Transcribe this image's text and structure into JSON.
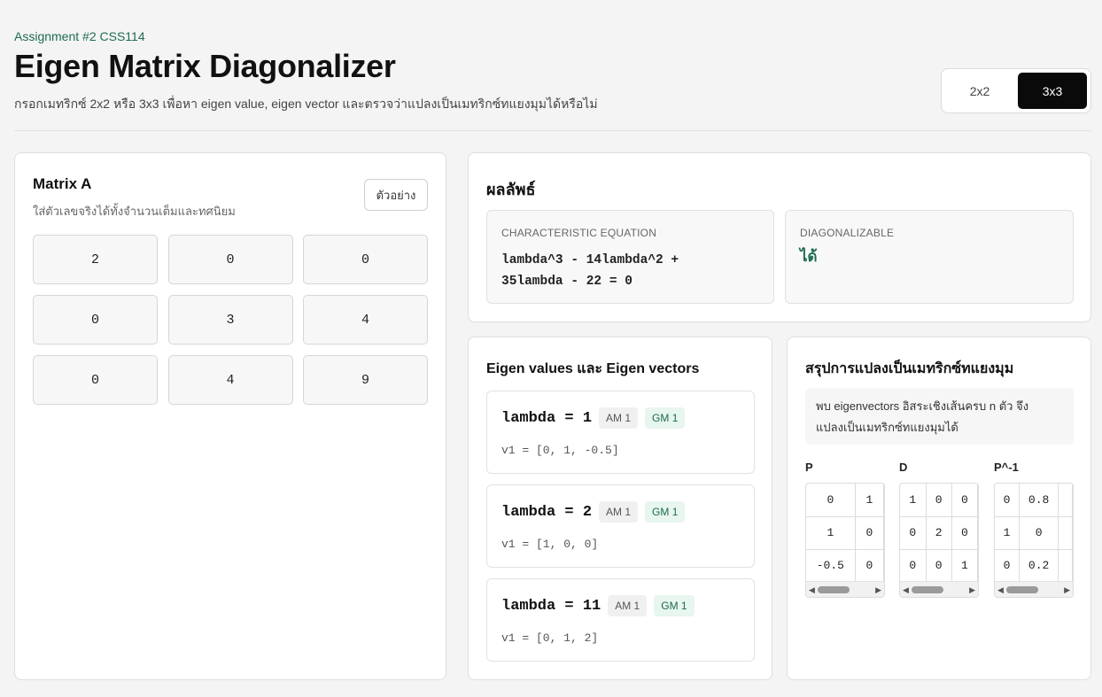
{
  "header": {
    "course": "Assignment #2 CSS114",
    "title": "Eigen Matrix Diagonalizer",
    "subtitle": "กรอกเมทริกซ์ 2x2 หรือ 3x3 เพื่อหา eigen value, eigen vector และตรวจว่าแปลงเป็นเมทริกซ์ทแยงมุมได้หรือไม่"
  },
  "size_toggle": {
    "options": [
      "2x2",
      "3x3"
    ],
    "selected": "3x3"
  },
  "matrix_card": {
    "title": "Matrix A",
    "hint": "ใส่ตัวเลขจริงได้ทั้งจำนวนเต็มและทศนิยม",
    "example_button": "ตัวอย่าง",
    "cells": [
      [
        "2",
        "0",
        "0"
      ],
      [
        "0",
        "3",
        "4"
      ],
      [
        "0",
        "4",
        "9"
      ]
    ]
  },
  "results": {
    "title": "ผลลัพธ์",
    "char_eq_label": "CHARACTERISTIC EQUATION",
    "char_eq_line1": "lambda^3 - 14lambda^2 +",
    "char_eq_line2": "35lambda - 22 = 0",
    "diag_label": "DIAGONALIZABLE",
    "diag_value": "ได้",
    "diag_color": "#1f6b4f"
  },
  "eigen": {
    "title": "Eigen values และ Eigen vectors",
    "items": [
      {
        "lambda": "lambda = 1",
        "am": "AM 1",
        "gm": "GM 1",
        "vector": "v1 = [0, 1, -0.5]"
      },
      {
        "lambda": "lambda = 2",
        "am": "AM 1",
        "gm": "GM 1",
        "vector": "v1 = [1, 0, 0]"
      },
      {
        "lambda": "lambda = 11",
        "am": "AM 1",
        "gm": "GM 1",
        "vector": "v1 = [0, 1, 2]"
      }
    ]
  },
  "summary": {
    "title": "สรุปการแปลงเป็นเมทริกซ์ทแยงมุม",
    "note_line1": "พบ eigenvectors อิสระเชิงเส้นครบ n ตัว จึง",
    "note_line2": "แปลงเป็นเมทริกซ์ทแยงมุมได้",
    "matrices": [
      {
        "label": "P",
        "rows": [
          [
            "0",
            "1"
          ],
          [
            "1",
            "0"
          ],
          [
            "-0.5",
            "0"
          ]
        ]
      },
      {
        "label": "D",
        "rows": [
          [
            "1",
            "0",
            "0"
          ],
          [
            "0",
            "2",
            "0"
          ],
          [
            "0",
            "0",
            "1"
          ]
        ]
      },
      {
        "label": "P^-1",
        "rows": [
          [
            "0",
            "0.8",
            ""
          ],
          [
            "1",
            "0",
            ""
          ],
          [
            "0",
            "0.2",
            ""
          ]
        ]
      }
    ]
  },
  "colors": {
    "accent_green": "#1f6b4f",
    "toggle_active_bg": "#0a0a0a"
  }
}
